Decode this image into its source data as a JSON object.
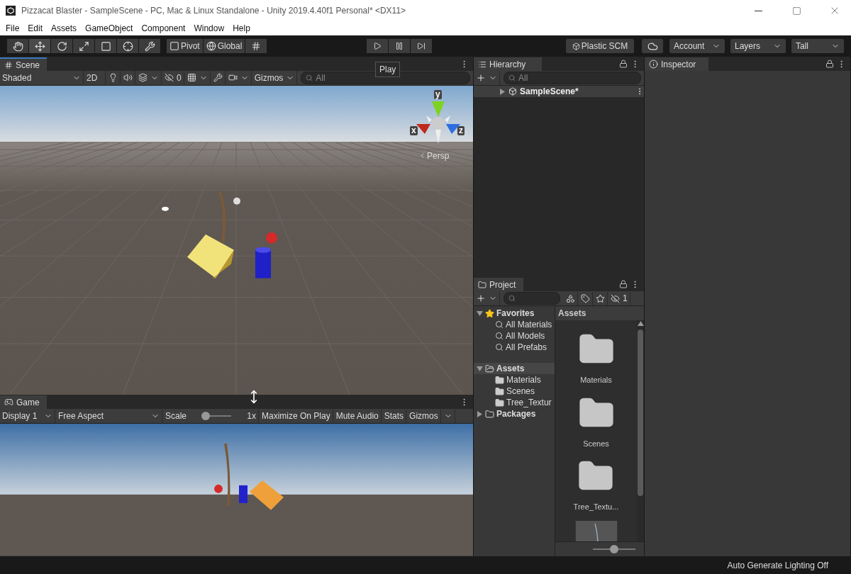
{
  "window": {
    "title": "Pizzacat Blaster - SampleScene - PC, Mac & Linux Standalone - Unity 2019.4.40f1 Personal* <DX11>"
  },
  "menu": [
    "File",
    "Edit",
    "Assets",
    "GameObject",
    "Component",
    "Window",
    "Help"
  ],
  "toolbar": {
    "tools": [
      {
        "kind": "hand",
        "selected": false
      },
      {
        "kind": "move",
        "selected": true
      },
      {
        "kind": "rotate",
        "selected": false
      },
      {
        "kind": "scale",
        "selected": false
      },
      {
        "kind": "rect",
        "selected": false
      },
      {
        "kind": "transform",
        "selected": false
      },
      {
        "kind": "custom",
        "selected": false
      }
    ],
    "pivot": "Pivot",
    "space": "Global",
    "playback": [
      {
        "kind": "play"
      },
      {
        "kind": "pause"
      },
      {
        "kind": "step"
      }
    ],
    "collab": "Plastic SCM",
    "account": "Account",
    "layers": "Layers",
    "layout": "Tall"
  },
  "tooltip": "Play",
  "scene": {
    "tab": "Scene",
    "shading": "Shaded",
    "mode_2d": "2D",
    "hidden_count": "0",
    "gizmos": "Gizmos",
    "search_placeholder": "All",
    "axes": {
      "x": "x",
      "y": "y",
      "z": "z"
    },
    "projection": "Persp"
  },
  "game": {
    "tab": "Game",
    "display": "Display 1",
    "aspect": "Free Aspect",
    "scale_label": "Scale",
    "scale": {
      "level": 0.1
    },
    "scale_value": "1x",
    "buttons": [
      "Maximize On Play",
      "Mute Audio",
      "Stats",
      "Gizmos"
    ]
  },
  "hierarchy": {
    "tab": "Hierarchy",
    "search_placeholder": "All",
    "items": [
      {
        "name": "SampleScene*",
        "expanded": false
      }
    ]
  },
  "project": {
    "tab": "Project",
    "hidden_count": "1",
    "favorites": {
      "label": "Favorites",
      "expanded": true,
      "children": [
        "All Materials",
        "All Models",
        "All Prefabs"
      ]
    },
    "tree": [
      {
        "label": "Assets",
        "expanded": true,
        "selected": true,
        "children": [
          {
            "label": "Materials"
          },
          {
            "label": "Scenes"
          },
          {
            "label": "Tree_Textur"
          }
        ]
      },
      {
        "label": "Packages",
        "expanded": false,
        "selected": false
      }
    ],
    "breadcrumb": "Assets",
    "assets": [
      {
        "kind": "folder",
        "name": "Materials"
      },
      {
        "kind": "folder",
        "name": "Scenes"
      },
      {
        "kind": "folder",
        "name": "Tree_Textu..."
      },
      {
        "kind": "texture"
      }
    ],
    "thumbnail_size": {
      "level": 0.5
    }
  },
  "inspector": {
    "tab": "Inspector"
  },
  "status": "Auto Generate Lighting Off"
}
